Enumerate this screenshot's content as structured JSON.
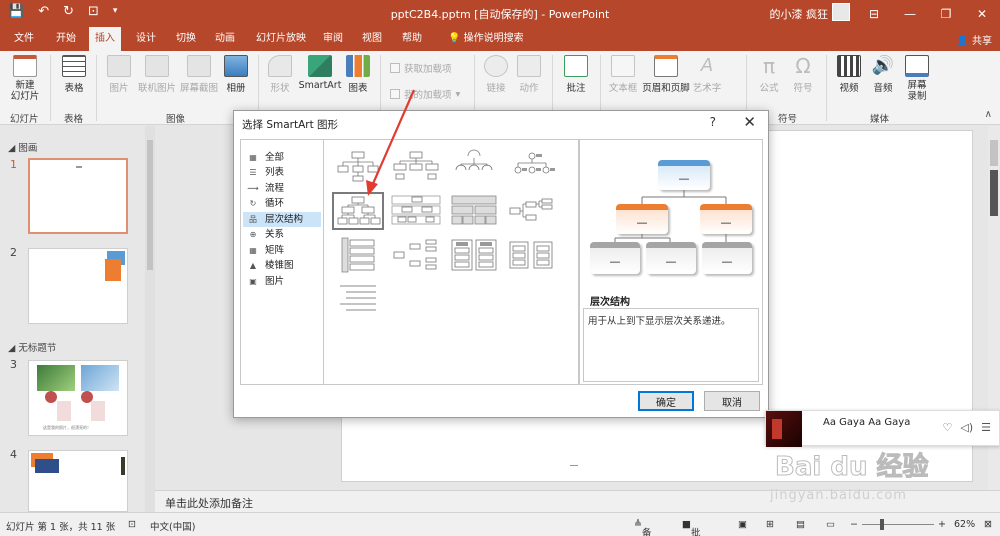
{
  "titlebar": {
    "doc_title": "pptC2B4.pptm [自动保存的] - PowerPoint",
    "user": "的小漆 疯狂",
    "minimize": "—",
    "restore": "❐",
    "close": "✕"
  },
  "tabs": [
    "文件",
    "开始",
    "插入",
    "设计",
    "切换",
    "动画",
    "幻灯片放映",
    "审阅",
    "视图",
    "帮助",
    "操作说明搜索"
  ],
  "share": "共享",
  "ribbon": {
    "new_slide": "新建\n幻灯片",
    "table": "表格",
    "picture": "图片",
    "online_picture": "联机图片",
    "screenshot": "屏幕截图",
    "album": "相册",
    "shapes": "形状",
    "smartart": "SmartArt",
    "chart": "图表",
    "get_addins": "获取加载项",
    "my_addins": "我的加载项",
    "link": "链接",
    "action": "动作",
    "comment": "批注",
    "textbox": "文本框",
    "header_footer": "页眉和页脚",
    "wordart": "艺术字",
    "equation": "公式",
    "symbol": "符号",
    "video": "视频",
    "audio": "音频",
    "screen_record": "屏幕\n录制",
    "groups": {
      "slides": "幻灯片",
      "tables": "表格",
      "images": "图像",
      "symbols": "符号",
      "media": "媒体"
    }
  },
  "slides_pane": {
    "section1": "图画",
    "section2": "无标题节",
    "nums": [
      "1",
      "2",
      "3",
      "4"
    ],
    "thumb3_caption": "这是我的照片，很漂亮的！"
  },
  "notes_placeholder": "单击此处添加备注",
  "dialog": {
    "title": "选择 SmartArt 图形",
    "help": "?",
    "close": "✕",
    "categories": [
      "全部",
      "列表",
      "流程",
      "循环",
      "层次结构",
      "关系",
      "矩阵",
      "棱锥图",
      "图片"
    ],
    "category_icons": [
      "▦",
      "☰",
      "⟿",
      "↻",
      "品",
      "⊕",
      "▦",
      "▲",
      "▣"
    ],
    "preview_name": "层次结构",
    "preview_desc": "用于从上到下显示层次关系递进。",
    "preview_dash": "—",
    "ok": "确定",
    "cancel": "取消"
  },
  "statusbar": {
    "slide_info": "幻灯片 第 1 张，共 11 张",
    "language": "中文(中国)",
    "notes": "备注",
    "comments": "批注",
    "zoom": "62%"
  },
  "music": {
    "song": "Aa Gaya Aa Gaya"
  },
  "watermark": {
    "brand": "Bai du 经验",
    "url": "jingyan.baidu.com"
  },
  "colors": {
    "accent": "#b7472a",
    "selection": "#cce4f7",
    "arrow": "#e03c31"
  }
}
